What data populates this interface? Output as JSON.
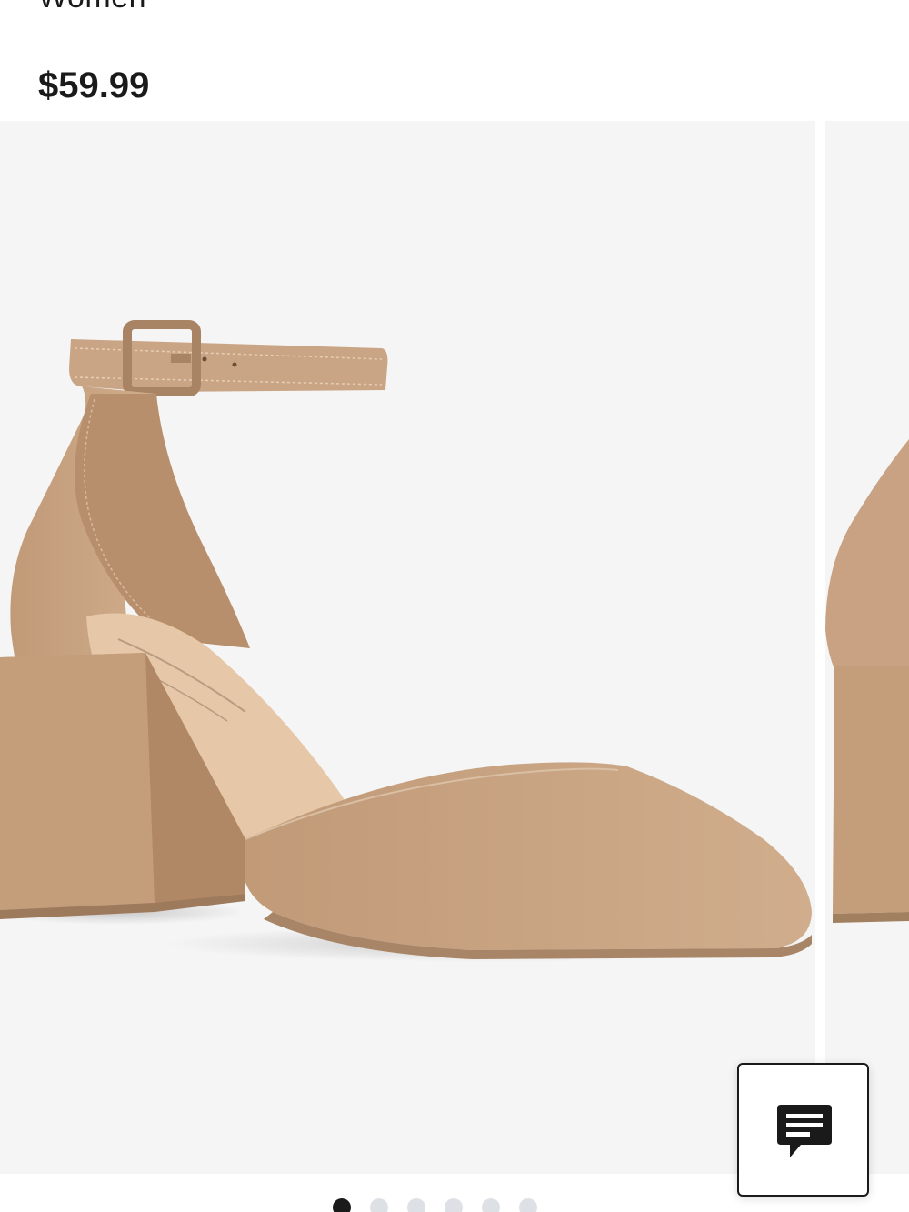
{
  "product": {
    "gender": "Women",
    "price": "$59.99"
  },
  "gallery": {
    "current_image": "beige-block-heel-pump-ankle-strap",
    "dot_count": 6,
    "active_dot": 1
  },
  "chat": {
    "icon": "chat-icon"
  },
  "colors": {
    "background": "#ffffff",
    "image_background": "#f5f5f5",
    "shoe": "#c9a484",
    "text": "#1a1a1a",
    "dot_active": "#1a1a1a",
    "dot_inactive": "#dde1e5"
  }
}
